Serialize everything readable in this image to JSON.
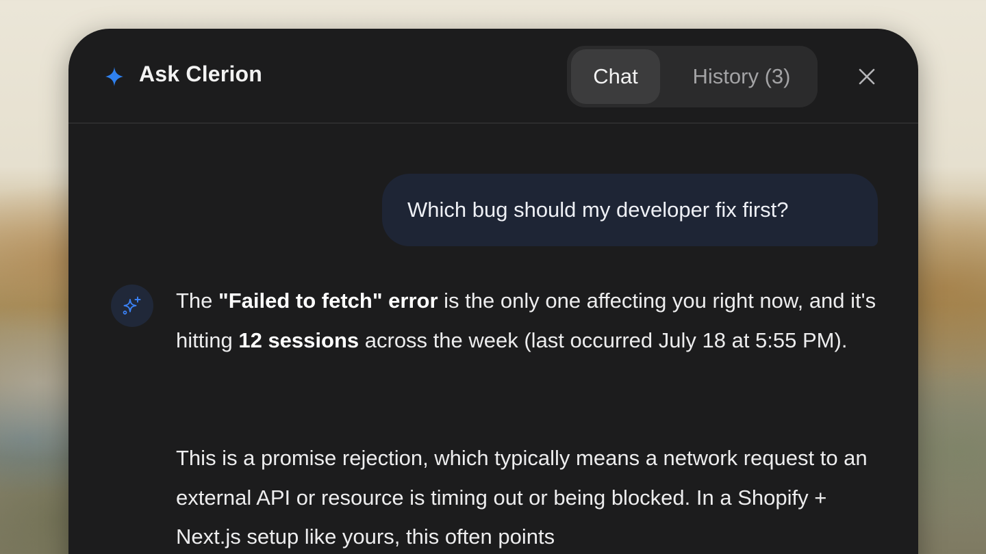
{
  "header": {
    "title": "Ask Clerion",
    "tabs": [
      {
        "label": "Chat",
        "active": true
      },
      {
        "label": "History (3)",
        "active": false
      }
    ],
    "icons": {
      "brand": "sparkle-icon",
      "close": "close-icon"
    }
  },
  "conversation": {
    "user_message": "Which bug should my developer fix first?",
    "assistant": {
      "avatar_icon": "sparkles-icon",
      "paragraph1": {
        "t1": "The ",
        "b1": "\"Failed to fetch\" error",
        "t2": " is the only one affecting you right now, and it's hitting ",
        "b2": "12 sessions",
        "t3": " across the week (last occurred July 18 at 5:55 PM)."
      },
      "paragraph2": "This is a promise rejection, which typically means a network request to an external API or resource is timing out or being blocked. In a Shopify + Next.js setup like yours, this often points"
    }
  },
  "colors": {
    "panel_bg": "#1c1c1d",
    "accent_blue": "#2f80ed",
    "user_bubble": "#1e2535"
  }
}
